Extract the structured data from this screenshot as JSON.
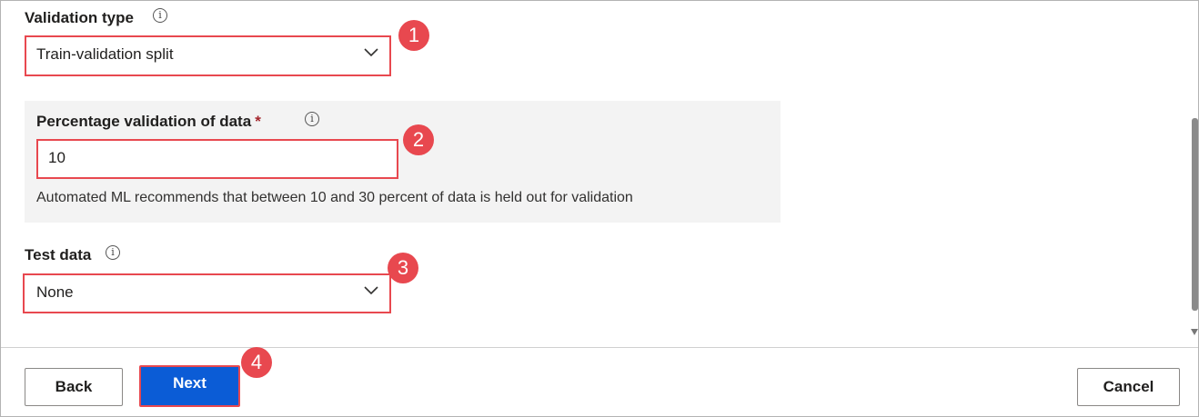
{
  "validation_type": {
    "label": "Validation type",
    "value": "Train-validation split",
    "badge": "1"
  },
  "percentage_validation": {
    "label": "Percentage validation of data",
    "required_marker": "*",
    "value": "10",
    "hint": "Automated ML recommends that between 10 and 30 percent of data is held out for validation",
    "badge": "2"
  },
  "test_data": {
    "label": "Test data",
    "value": "None",
    "badge": "3"
  },
  "footer": {
    "back_label": "Back",
    "next_label": "Next",
    "cancel_label": "Cancel",
    "next_badge": "4"
  },
  "icons": {
    "info": "info-icon",
    "dropdown": "chevron-down-icon"
  },
  "colors": {
    "highlight": "#e8484f",
    "primary": "#0b5cd6",
    "panel": "#f3f3f3"
  }
}
